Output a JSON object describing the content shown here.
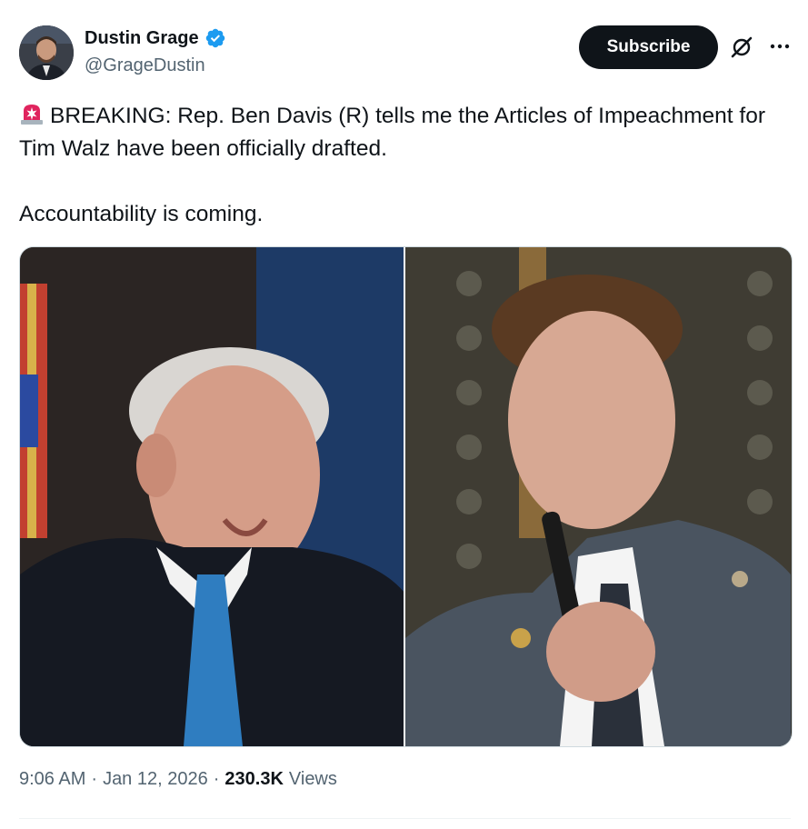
{
  "author": {
    "display_name": "Dustin Grage",
    "handle": "@GrageDustin",
    "verified_icon": "verified-badge-icon",
    "verified_color": "#1d9bf0"
  },
  "actions": {
    "subscribe_label": "Subscribe",
    "grok_icon": "grok-icon",
    "more_icon": "more-options-icon"
  },
  "tweet": {
    "emoji": "rotating-light-siren-icon",
    "line1": "BREAKING: Rep. Ben Davis (R) tells me the Articles of Impeachment for Tim Walz have been officially drafted.",
    "line2": "Accountability is coming."
  },
  "media": {
    "left_photo": "photo of man with white hair looking down, dark suit, blue tie",
    "right_photo": "photo of man in grey suit holding a microphone"
  },
  "meta": {
    "time": "9:06 AM",
    "separator1": "·",
    "date": "Jan 12, 2026",
    "separator2": "·",
    "views_count": "230.3K",
    "views_label": "Views"
  },
  "colors": {
    "text_primary": "#0f1419",
    "text_secondary": "#536471",
    "subscribe_bg": "#0f1419",
    "accent": "#1d9bf0"
  }
}
